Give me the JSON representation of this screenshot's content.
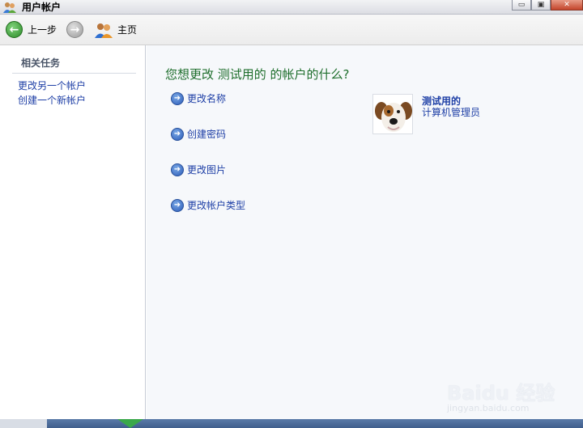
{
  "window": {
    "title": "用户帐户",
    "controls": {
      "minimize": "▭",
      "maximize": "▣",
      "close": "✕"
    }
  },
  "toolbar": {
    "back_label": "上一步",
    "home_label": "主页",
    "back_glyph": "←",
    "forward_glyph": "→"
  },
  "sidebar": {
    "title": "相关任务",
    "links": [
      "更改另一个帐户",
      "创建一个新帐户"
    ]
  },
  "main": {
    "question": "您想更改 测试用的 的帐户的什么?",
    "tasks": [
      "更改名称",
      "创建密码",
      "更改图片",
      "更改帐户类型"
    ],
    "task_arrow": "➜"
  },
  "account": {
    "name": "测试用的",
    "type": "计算机管理员",
    "picture": "dog-avatar"
  },
  "watermark": {
    "main": "Baidu 经验",
    "sub": "jingyan.baidu.com"
  },
  "colors": {
    "link": "#1e3fa6",
    "question": "#1e6e2c",
    "main_bg": "#f6f8fb"
  }
}
